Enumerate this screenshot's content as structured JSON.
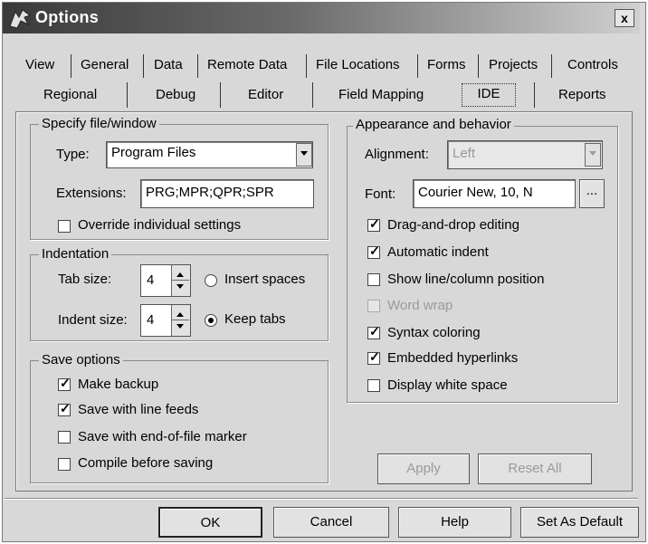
{
  "window": {
    "title": "Options",
    "close": "x"
  },
  "tabs": {
    "row1": [
      "View",
      "General",
      "Data",
      "Remote Data",
      "File Locations",
      "Forms",
      "Projects",
      "Controls"
    ],
    "row2": [
      "Regional",
      "Debug",
      "Editor",
      "Field Mapping",
      "IDE",
      "Reports"
    ],
    "active": "IDE"
  },
  "specify": {
    "legend": "Specify file/window",
    "type_label": "Type:",
    "type_value": "Program Files",
    "ext_label": "Extensions:",
    "ext_value": "PRG;MPR;QPR;SPR",
    "override_label": "Override individual settings",
    "override_checked": false
  },
  "indentation": {
    "legend": "Indentation",
    "tab_size_label": "Tab size:",
    "tab_size_value": "4",
    "indent_size_label": "Indent size:",
    "indent_size_value": "4",
    "insert_spaces_label": "Insert spaces",
    "keep_tabs_label": "Keep tabs",
    "selected": "Keep tabs"
  },
  "save_options": {
    "legend": "Save options",
    "items": [
      {
        "label": "Make backup",
        "checked": true
      },
      {
        "label": "Save with line feeds",
        "checked": true
      },
      {
        "label": "Save with end-of-file marker",
        "checked": false
      },
      {
        "label": "Compile before saving",
        "checked": false
      }
    ]
  },
  "appearance": {
    "legend": "Appearance and behavior",
    "alignment_label": "Alignment:",
    "alignment_value": "Left",
    "font_label": "Font:",
    "font_value": "Courier New, 10, N",
    "font_button": "...",
    "items": [
      {
        "label": "Drag-and-drop editing",
        "checked": true,
        "enabled": true
      },
      {
        "label": "Automatic indent",
        "checked": true,
        "enabled": true
      },
      {
        "label": "Show line/column position",
        "checked": false,
        "enabled": true
      },
      {
        "label": "Word wrap",
        "checked": false,
        "enabled": false
      },
      {
        "label": "Syntax coloring",
        "checked": true,
        "enabled": true
      },
      {
        "label": "Embedded hyperlinks",
        "checked": true,
        "enabled": true
      },
      {
        "label": "Display white space",
        "checked": false,
        "enabled": true
      }
    ]
  },
  "panel_buttons": {
    "apply": "Apply",
    "reset_all": "Reset All"
  },
  "footer_buttons": {
    "ok": "OK",
    "cancel": "Cancel",
    "help": "Help",
    "set_default": "Set As Default"
  }
}
